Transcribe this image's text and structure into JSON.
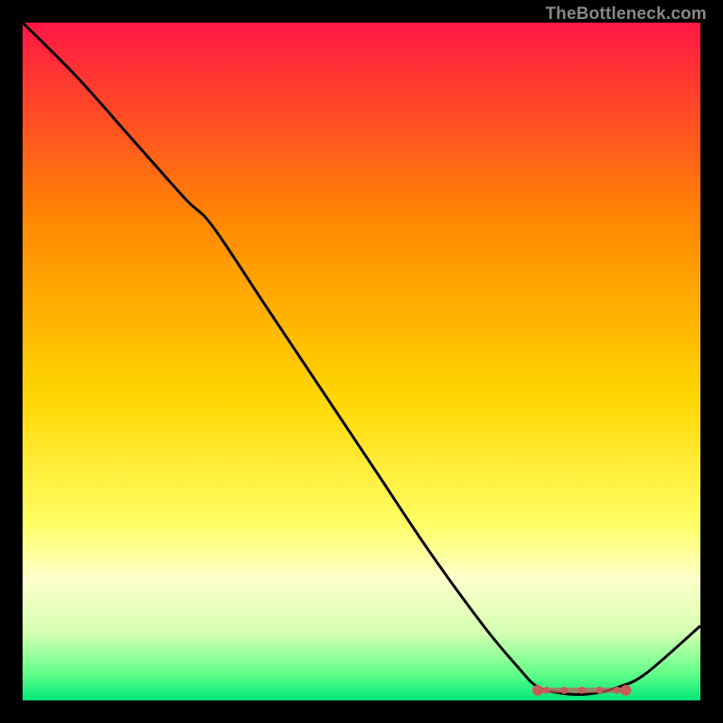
{
  "watermark": "TheBottleneck.com",
  "chart_data": {
    "type": "line",
    "title": "",
    "xlabel": "",
    "ylabel": "",
    "xlim": [
      0,
      100
    ],
    "ylim": [
      0,
      100
    ],
    "background": "gradient-heatmap",
    "gradient_stops": [
      {
        "offset": 0,
        "color": "#ff1744"
      },
      {
        "offset": 30,
        "color": "#ff8a00"
      },
      {
        "offset": 55,
        "color": "#ffd600"
      },
      {
        "offset": 74,
        "color": "#ffff66"
      },
      {
        "offset": 82,
        "color": "#ffffcc"
      },
      {
        "offset": 90,
        "color": "#d4ffb0"
      },
      {
        "offset": 96,
        "color": "#64ff8a"
      },
      {
        "offset": 100,
        "color": "#00e676"
      }
    ],
    "series": [
      {
        "name": "bottleneck-curve",
        "color": "#000000",
        "x": [
          0,
          8,
          16,
          24,
          28,
          36,
          44,
          52,
          60,
          68,
          73,
          76,
          80,
          84,
          88,
          92,
          100
        ],
        "values": [
          100,
          92,
          83,
          74,
          70,
          58,
          46,
          34,
          22,
          11,
          5,
          2,
          1,
          1,
          2,
          4,
          11
        ]
      }
    ],
    "optimum_marker": {
      "name": "sweet-spot-range",
      "color": "#c95a5a",
      "x_start": 76,
      "x_end": 89,
      "y": 1.5
    }
  }
}
